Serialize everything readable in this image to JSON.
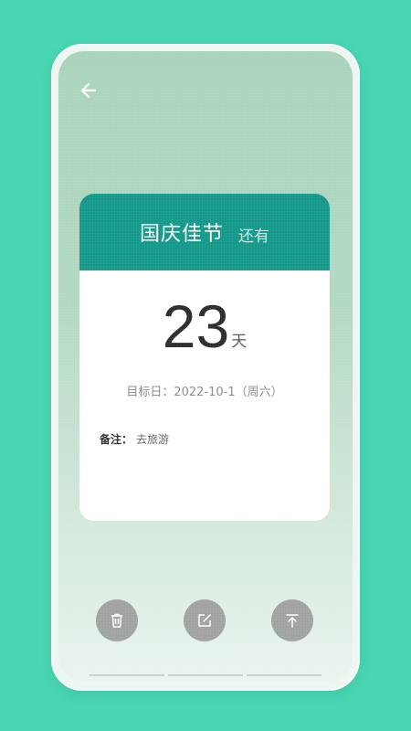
{
  "event": {
    "title": "国庆佳节",
    "status_label": "还有"
  },
  "countdown": {
    "value": "23",
    "unit": "天"
  },
  "target": {
    "text": "目标日：2022-10-1（周六）"
  },
  "note": {
    "label": "备注：",
    "value": "去旅游"
  },
  "icons": {
    "back": "arrow-left-icon",
    "delete": "trash-icon",
    "edit": "edit-icon",
    "top": "pin-top-icon"
  },
  "colors": {
    "background": "#48d6b3",
    "header": "#13988a",
    "action_button": "#a1a39f"
  }
}
